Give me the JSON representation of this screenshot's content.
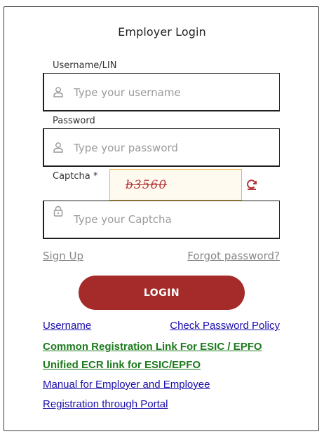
{
  "form": {
    "title": "Employer Login",
    "username_label": "Username/LIN",
    "username_placeholder": "Type your username",
    "password_label": "Password",
    "password_placeholder": "Type your password",
    "captcha_label": "Captcha *",
    "captcha_text": "b3560",
    "captcha_placeholder": "Type your Captcha",
    "signup_link": "Sign Up",
    "forgot_link": "Forgot password?",
    "login_button": "LOGIN"
  },
  "links": {
    "username": "Username",
    "check_password_policy": "Check Password Policy",
    "common_registration": "Common Registration Link For ESIC / EPFO",
    "unified_ecr": "Unified ECR link for ESIC/EPFO",
    "manual": "Manual for Employer and Employee",
    "registration_portal": "Registration through Portal"
  },
  "icons": {
    "username_icon": "user-icon",
    "password_icon": "user-icon",
    "captcha_icon": "lock-icon",
    "refresh_icon": "refresh-icon"
  },
  "colors": {
    "login_button": "#a52a2a",
    "link_blue": "#1a0dab",
    "link_green": "#1e7a1e",
    "captcha_text": "#b5383a",
    "captcha_border": "#e8b84a"
  }
}
